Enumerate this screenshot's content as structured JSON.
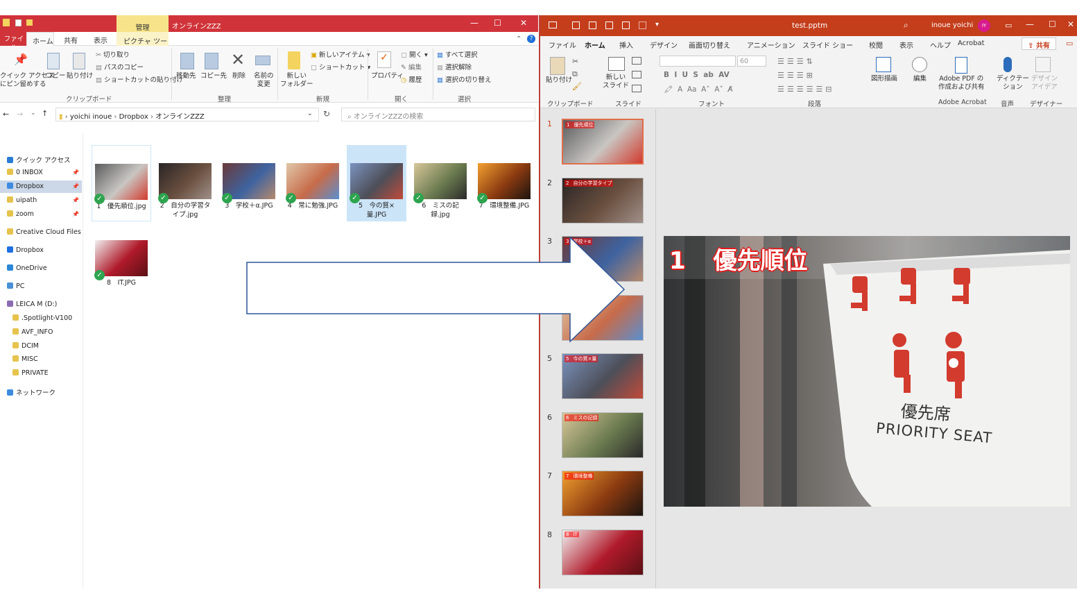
{
  "explorer": {
    "context_tab": "管理",
    "title": "オンラインZZZ",
    "window_buttons": [
      "—",
      "☐",
      "✕"
    ],
    "tabs": [
      "ファイル",
      "ホーム",
      "共有",
      "表示",
      "ピクチャ ツール"
    ],
    "ribbon": {
      "pin_label": "クイック アクセス\nにピン留めする",
      "copy": "コピー",
      "paste": "貼り付け",
      "cut": "切り取り",
      "copy_path": "パスのコピー",
      "paste_shortcut": "ショートカットの貼り付け",
      "group_clipboard": "クリップボード",
      "move_to": "移動先",
      "copy_to": "コピー先",
      "delete": "削除",
      "rename": "名前の\n変更",
      "group_organize": "整理",
      "new_folder": "新しい\nフォルダー",
      "new_item": "新しいアイテム ▾",
      "shortcut": "ショートカット ▾",
      "group_new": "新規",
      "properties": "プロパティ",
      "open": "開く ▾",
      "edit": "編集",
      "history": "履歴",
      "group_open": "開く",
      "select_all": "すべて選択",
      "select_none": "選択解除",
      "invert": "選択の切り替え",
      "group_select": "選択"
    },
    "address": {
      "crumbs": [
        "yoichi inoue",
        "Dropbox",
        "オンラインZZZ"
      ],
      "separator": "›"
    },
    "search_placeholder": "オンラインZZZの検索",
    "nav": [
      {
        "label": "クイック アクセス",
        "color": "#2b7cd3",
        "pinned": false
      },
      {
        "label": "0 INBOX",
        "color": "#e6c34d",
        "pinned": true
      },
      {
        "label": "Dropbox",
        "color": "#3d8be0",
        "pinned": true
      },
      {
        "label": "uipath",
        "color": "#e6c34d",
        "pinned": true
      },
      {
        "label": "zoom",
        "color": "#e6c34d",
        "pinned": true
      },
      {
        "label": "Creative Cloud Files",
        "color": "#e6c34d",
        "pinned": false
      },
      {
        "label": "Dropbox",
        "color": "#1f6fe0",
        "pinned": false
      },
      {
        "label": "OneDrive",
        "color": "#2b88d8",
        "pinned": false
      },
      {
        "label": "PC",
        "color": "#4a90d6",
        "pinned": false
      },
      {
        "label": "LEICA M (D:)",
        "color": "#8a6db0",
        "pinned": false
      },
      {
        "label": ".Spotlight-V100",
        "color": "#e6c34d",
        "pinned": false
      },
      {
        "label": "AVF_INFO",
        "color": "#e6c34d",
        "pinned": false
      },
      {
        "label": "DCIM",
        "color": "#e6c34d",
        "pinned": false
      },
      {
        "label": "MISC",
        "color": "#e6c34d",
        "pinned": false
      },
      {
        "label": "PRIVATE",
        "color": "#e6c34d",
        "pinned": false
      },
      {
        "label": "ネットワーク",
        "color": "#3d8be0",
        "pinned": false
      }
    ],
    "files": [
      {
        "name": "1　優先順位.jpg"
      },
      {
        "name": "2　自分の学習タイプ.jpg"
      },
      {
        "name": "3　学校＋α.JPG"
      },
      {
        "name": "4　常に勉強.JPG"
      },
      {
        "name": "5　今の質×量.JPG"
      },
      {
        "name": "6　ミスの記録.jpg"
      },
      {
        "name": "7　環境整備.JPG"
      },
      {
        "name": "8　IT.JPG"
      }
    ]
  },
  "powerpoint": {
    "title": "test.pptm",
    "user": "inoue yoichi",
    "avatar": "IY",
    "tabs": [
      "ファイル",
      "ホーム",
      "挿入",
      "デザイン",
      "画面切り替え",
      "アニメーション",
      "スライド ショー",
      "校閲",
      "表示",
      "ヘルプ",
      "Acrobat"
    ],
    "share": "共有",
    "ribbon": {
      "paste": "貼り付け",
      "clipboard": "クリップボード",
      "new_slide": "新しい\nスライド",
      "slides": "スライド",
      "font_size": "60",
      "font": "フォント",
      "paragraph": "段落",
      "shape": "図形描画",
      "edit": "編集",
      "adobe_pdf": "Adobe PDF の\n作成および共有",
      "adobe_acrobat": "Adobe Acrobat",
      "dictate": "ディクテー\nション",
      "voice": "音声",
      "design_ideas": "デザイン\nアイデア",
      "designer": "デザイナー"
    },
    "slides": [
      {
        "num": "1",
        "label": "優先順位"
      },
      {
        "num": "2",
        "label": "自分の学習タイプ"
      },
      {
        "num": "3",
        "label": "学校＋α"
      },
      {
        "num": "4",
        "label": "常に勉強"
      },
      {
        "num": "5",
        "label": "今の質×量"
      },
      {
        "num": "6",
        "label": "ミスの記録"
      },
      {
        "num": "7",
        "label": "環境整備"
      },
      {
        "num": "8",
        "label": "IT"
      }
    ],
    "main_slide": {
      "num": "1",
      "title": "優先順位",
      "sign_jp": "優先席",
      "sign_en": "PRIORITY SEAT"
    }
  },
  "colors": {
    "accent_pp": "#c43e1c",
    "accent_exp": "#d0343a",
    "arrow": "#2f5597"
  }
}
